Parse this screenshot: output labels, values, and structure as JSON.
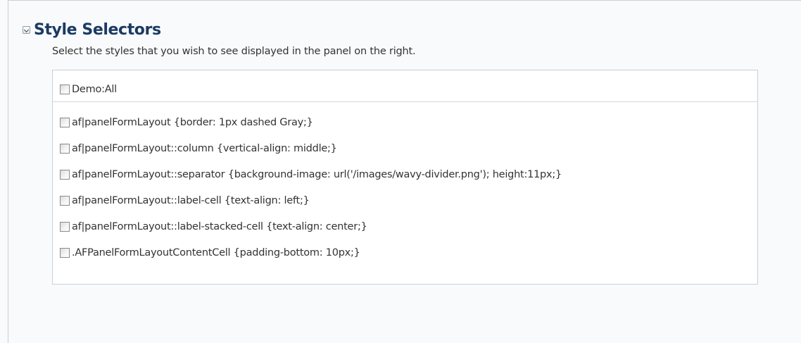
{
  "section": {
    "title": "Style Selectors",
    "description": "Select the styles that you wish to see displayed in the panel on the right."
  },
  "selectors": [
    {
      "label": "Demo:All",
      "checked": false
    },
    {
      "label": "af|panelFormLayout {border: 1px dashed Gray;}",
      "checked": false
    },
    {
      "label": "af|panelFormLayout::column {vertical-align: middle;}",
      "checked": false
    },
    {
      "label": "af|panelFormLayout::separator {background-image: url('/images/wavy-divider.png'); height:11px;}",
      "checked": false
    },
    {
      "label": "af|panelFormLayout::label-cell {text-align: left;}",
      "checked": false
    },
    {
      "label": "af|panelFormLayout::label-stacked-cell {text-align: center;}",
      "checked": false
    },
    {
      "label": ".AFPanelFormLayoutContentCell {padding-bottom: 10px;}",
      "checked": false
    }
  ],
  "icons": {
    "disclosure": "chevron-down-icon"
  },
  "colors": {
    "title": "#1b3a64",
    "text": "#333333",
    "border": "#c9d0d6",
    "background": "#f9fafb"
  }
}
